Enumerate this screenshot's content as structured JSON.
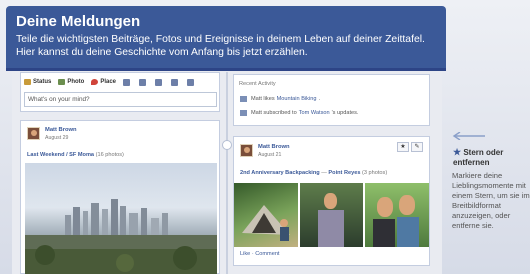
{
  "banner": {
    "title": "Deine Meldungen",
    "text": "Teile die wichtigsten Beiträge, Fotos und Ereignisse in deinem Leben auf deiner Zeittafel. Hier kannst du deine Geschichte vom Anfang bis jetzt erzählen."
  },
  "composer": {
    "tabs": [
      "Status",
      "Photo",
      "Place"
    ],
    "placeholder": "What's on your mind?"
  },
  "post_left": {
    "author": "Matt Brown",
    "date": "August 29",
    "album": "Last Weekend / SF Moma",
    "album_count": "(16 photos)"
  },
  "activity": {
    "title": "Recent Activity",
    "rows": [
      {
        "pre": "Matt likes",
        "link": "Mountain Biking",
        "post": "."
      },
      {
        "pre": "Matt subscribed to",
        "link": "Tom Watson",
        "post": "'s updates."
      }
    ]
  },
  "post_right": {
    "author": "Matt Brown",
    "date": "August 21",
    "album_pre": "2nd Anniversary Backpacking",
    "album_link": "Point Reyes",
    "album_count": "(3 photos)",
    "actions": "Like · Comment"
  },
  "tip": {
    "title": "Stern oder entfernen",
    "body": "Markiere deine Lieblingsmomente mit einem Stern, um sie im Breitbildformat anzuzeigen, oder entferne sie."
  },
  "colors": {
    "brand": "#3b5998",
    "background": "#dfe3ee"
  },
  "icons": [
    "status-icon",
    "photo-icon",
    "place-icon",
    "star-icon",
    "pencil-icon",
    "arrow-left-icon"
  ]
}
